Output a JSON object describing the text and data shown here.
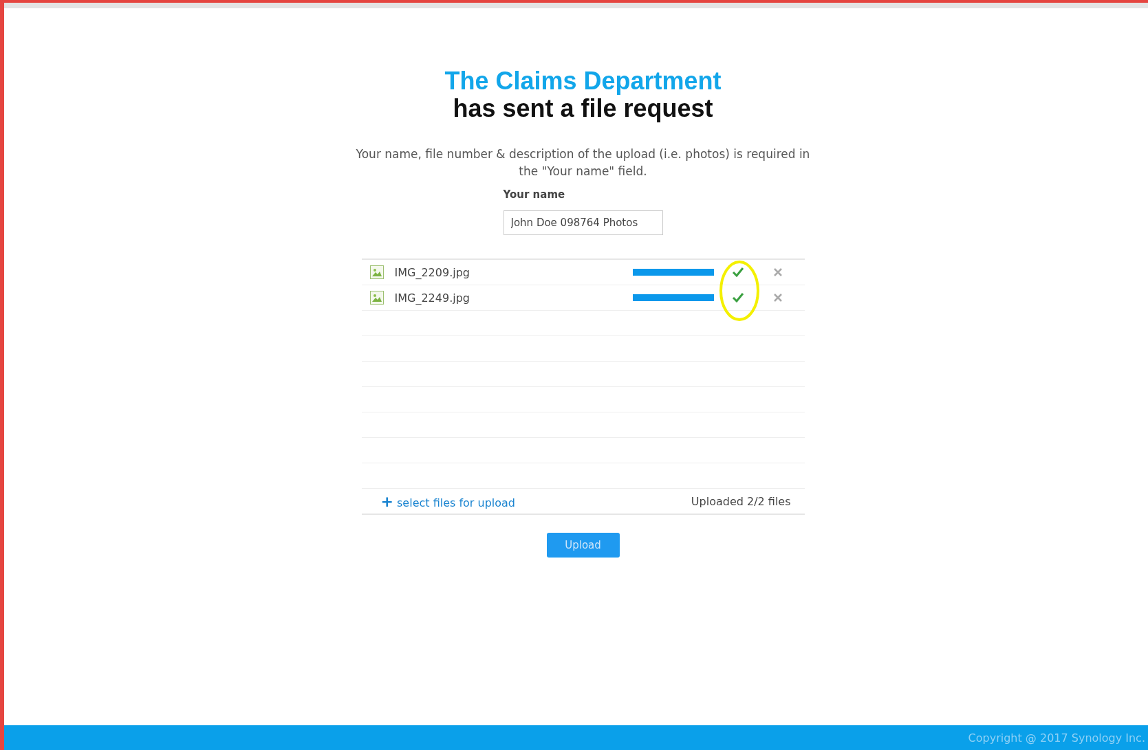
{
  "header": {
    "sender": "The Claims Department",
    "title": "has sent a file request"
  },
  "instructions": "Your name, file number & description of the upload (i.e. photos) is required in the \"Your name\" field.",
  "name_field": {
    "label": "Your name",
    "value": "John Doe 098764 Photos"
  },
  "files": [
    {
      "name": "IMG_2209.jpg",
      "level": 1,
      "done": true
    },
    {
      "name": "IMG_2249.jpg",
      "level": 1,
      "done": true
    }
  ],
  "annotation_ring": true,
  "add_link": {
    "icon": "+",
    "label": "select files for upload"
  },
  "upload_status": "Uploaded 2/2 files",
  "upload_button": "Upload",
  "footer": "Copyright @ 2017 Synology Inc."
}
